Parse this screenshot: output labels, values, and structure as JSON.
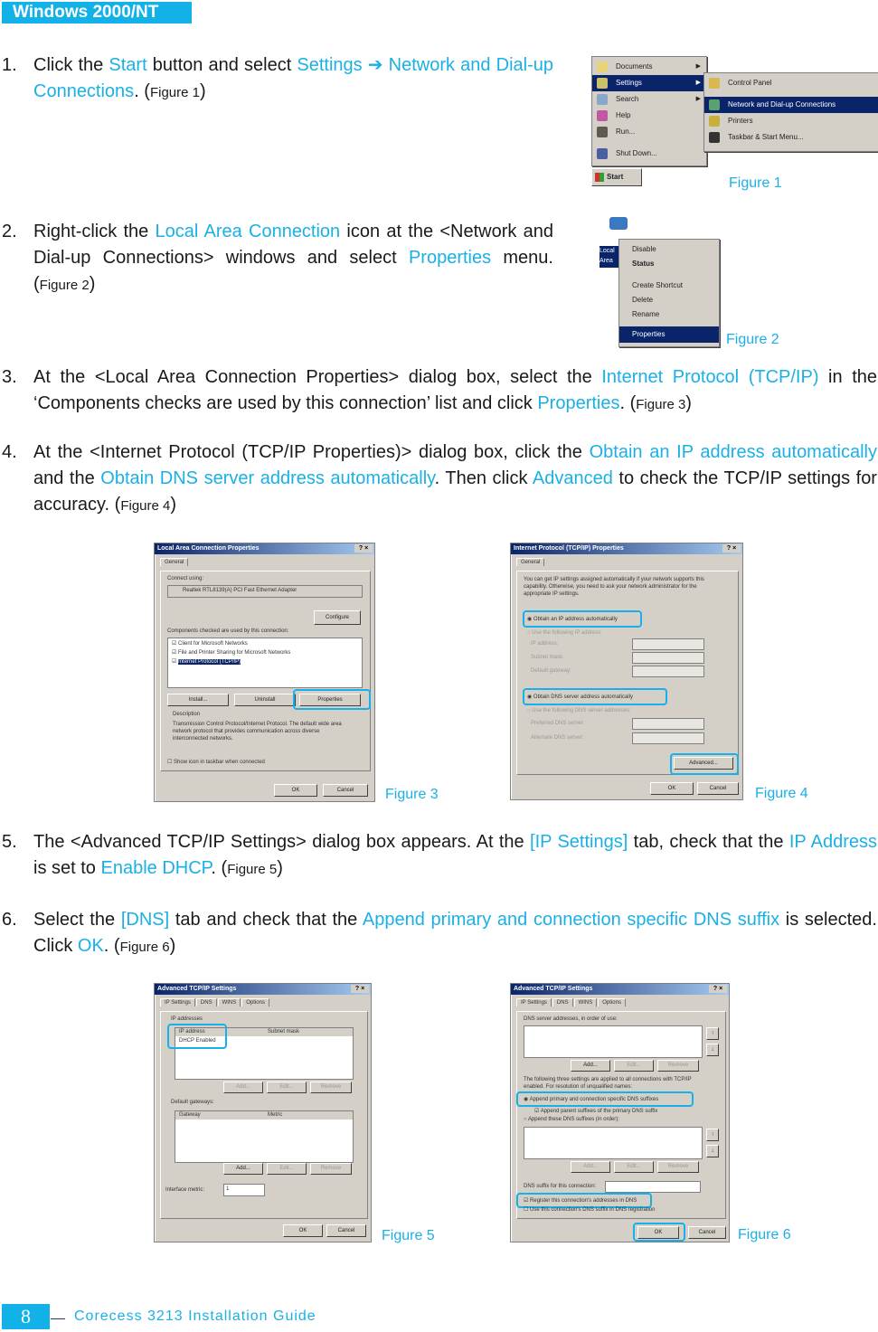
{
  "section_title": "Windows 2000/NT",
  "steps": [
    {
      "number": "1.",
      "segments": [
        {
          "t": "Click the "
        },
        {
          "t": "Start",
          "hl": true
        },
        {
          "t": " button and select "
        },
        {
          "t": "Settings ➔ Network and Dial-up Connections",
          "hl": true
        },
        {
          "t": ". ("
        },
        {
          "t": "Figure 1",
          "small": true
        },
        {
          "t": ")"
        }
      ]
    },
    {
      "number": "2.",
      "segments": [
        {
          "t": "Right-click the "
        },
        {
          "t": "Local Area Connection",
          "hl": true
        },
        {
          "t": " icon at the <Network and Dial-up Connections> windows and select "
        },
        {
          "t": "Properties",
          "hl": true
        },
        {
          "t": " menu. ("
        },
        {
          "t": "Figure 2",
          "small": true
        },
        {
          "t": ")"
        }
      ]
    },
    {
      "number": "3.",
      "segments": [
        {
          "t": "At the <Local Area Connection Properties> dialog box, select the "
        },
        {
          "t": "Internet Protocol (TCP/IP)",
          "hl": true
        },
        {
          "t": " in the ‘Components checks are used by this connection’ list and click "
        },
        {
          "t": "Properties",
          "hl": true
        },
        {
          "t": ". ("
        },
        {
          "t": "Figure 3",
          "small": true
        },
        {
          "t": ")"
        }
      ]
    },
    {
      "number": "4.",
      "segments": [
        {
          "t": "At the <Internet Protocol (TCP/IP Properties)> dialog box, click the "
        },
        {
          "t": "Obtain an IP address automatically",
          "hl": true
        },
        {
          "t": " and the "
        },
        {
          "t": "Obtain DNS server address automatically",
          "hl": true
        },
        {
          "t": ". Then click "
        },
        {
          "t": "Advanced",
          "hl": true
        },
        {
          "t": " to check the TCP/IP settings for accuracy. ("
        },
        {
          "t": "Figure 4",
          "small": true
        },
        {
          "t": ")"
        }
      ]
    },
    {
      "number": "5.",
      "segments": [
        {
          "t": "The <Advanced TCP/IP Settings> dialog box appears. At the "
        },
        {
          "t": "[IP Settings]",
          "hl": true
        },
        {
          "t": " tab, check that the "
        },
        {
          "t": "IP Address",
          "hl": true
        },
        {
          "t": " is set to "
        },
        {
          "t": "Enable DHCP",
          "hl": true
        },
        {
          "t": ". ("
        },
        {
          "t": "Figure 5",
          "small": true
        },
        {
          "t": ")"
        }
      ]
    },
    {
      "number": "6.",
      "segments": [
        {
          "t": "Select the "
        },
        {
          "t": "[DNS]",
          "hl": true
        },
        {
          "t": " tab and check that the "
        },
        {
          "t": "Append primary and connection specific DNS suffix",
          "hl": true
        },
        {
          "t": " is selected. Click "
        },
        {
          "t": "OK",
          "hl": true
        },
        {
          "t": ". ("
        },
        {
          "t": "Figure 6",
          "small": true
        },
        {
          "t": ")"
        }
      ]
    }
  ],
  "figures": {
    "fig1": {
      "label": "Figure 1",
      "start_menu": [
        "Documents",
        "Settings",
        "Search",
        "Help",
        "Run...",
        "Shut Down..."
      ],
      "settings_submenu": [
        "Control Panel",
        "Network and Dial-up Connections",
        "Printers",
        "Taskbar & Start Menu..."
      ],
      "start_button": "Start"
    },
    "fig2": {
      "label": "Figure 2",
      "icon_label": "Local Area Connection",
      "context_menu": [
        "Disable",
        "Status",
        "Create Shortcut",
        "Delete",
        "Rename",
        "Properties"
      ]
    },
    "fig3": {
      "label": "Figure 3",
      "title": "Local Area Connection Properties",
      "tab": "General",
      "connect_using_label": "Connect using:",
      "adapter": "Realtek RTL8139(A) PCI Fast Ethernet Adapter",
      "configure": "Configure",
      "components_label": "Components checked are used by this connection:",
      "components": [
        "Client for Microsoft Networks",
        "File and Printer Sharing for Microsoft Networks",
        "Internet Protocol (TCP/IP)"
      ],
      "install": "Install...",
      "uninstall": "Uninstall",
      "properties": "Properties",
      "description_label": "Description",
      "description": "Transmission Control Protocol/Internet Protocol. The default wide area network protocol that provides communication across diverse interconnected networks.",
      "show_icon": "Show icon in taskbar when connected",
      "ok": "OK",
      "cancel": "Cancel"
    },
    "fig4": {
      "label": "Figure 4",
      "title": "Internet Protocol (TCP/IP) Properties",
      "tab": "General",
      "intro": "You can get IP settings assigned automatically if your network supports this capability. Otherwise, you need to ask your network administrator for the appropriate IP settings.",
      "obtain_ip": "Obtain an IP address automatically",
      "use_ip": "Use the following IP address:",
      "ip_fields": [
        "IP address:",
        "Subnet mask:",
        "Default gateway:"
      ],
      "obtain_dns": "Obtain DNS server address automatically",
      "use_dns": "Use the following DNS server addresses:",
      "dns_fields": [
        "Preferred DNS server:",
        "Alternate DNS server:"
      ],
      "advanced": "Advanced...",
      "ok": "OK",
      "cancel": "Cancel"
    },
    "fig5": {
      "label": "Figure 5",
      "title": "Advanced TCP/IP Settings",
      "tabs": [
        "IP Settings",
        "DNS",
        "WINS",
        "Options"
      ],
      "ip_addresses_label": "IP addresses",
      "col_ip": "IP address",
      "col_mask": "Subnet mask",
      "ip_value": "DHCP Enabled",
      "btns1": [
        "Add...",
        "Edit...",
        "Remove"
      ],
      "gateways_label": "Default gateways:",
      "col_gateway": "Gateway",
      "col_metric": "Metric",
      "btns2": [
        "Add...",
        "Edit...",
        "Remove"
      ],
      "metric_label": "Interface metric:",
      "metric_value": "1",
      "ok": "OK",
      "cancel": "Cancel"
    },
    "fig6": {
      "label": "Figure 6",
      "title": "Advanced TCP/IP Settings",
      "tabs": [
        "IP Settings",
        "DNS",
        "WINS",
        "Options"
      ],
      "dns_list_label": "DNS server addresses, in order of use:",
      "btns1": [
        "Add...",
        "Edit...",
        "Remove"
      ],
      "resolution_text": "The following three settings are applied to all connections with TCP/IP enabled. For resolution of unqualified names:",
      "append_primary": "Append primary and connection specific DNS suffixes",
      "append_parent": "Append parent suffixes of the primary DNS suffix",
      "append_these": "Append these DNS suffixes (in order):",
      "btns2": [
        "Add...",
        "Edit...",
        "Remove"
      ],
      "suffix_label": "DNS suffix for this connection:",
      "register": "Register this connection's addresses in DNS",
      "use_suffix": "Use this connection's DNS suffix in DNS registration",
      "ok": "OK",
      "cancel": "Cancel"
    }
  },
  "footer": {
    "page_number": "8",
    "guide_title": "Corecess 3213 Installation Guide"
  }
}
